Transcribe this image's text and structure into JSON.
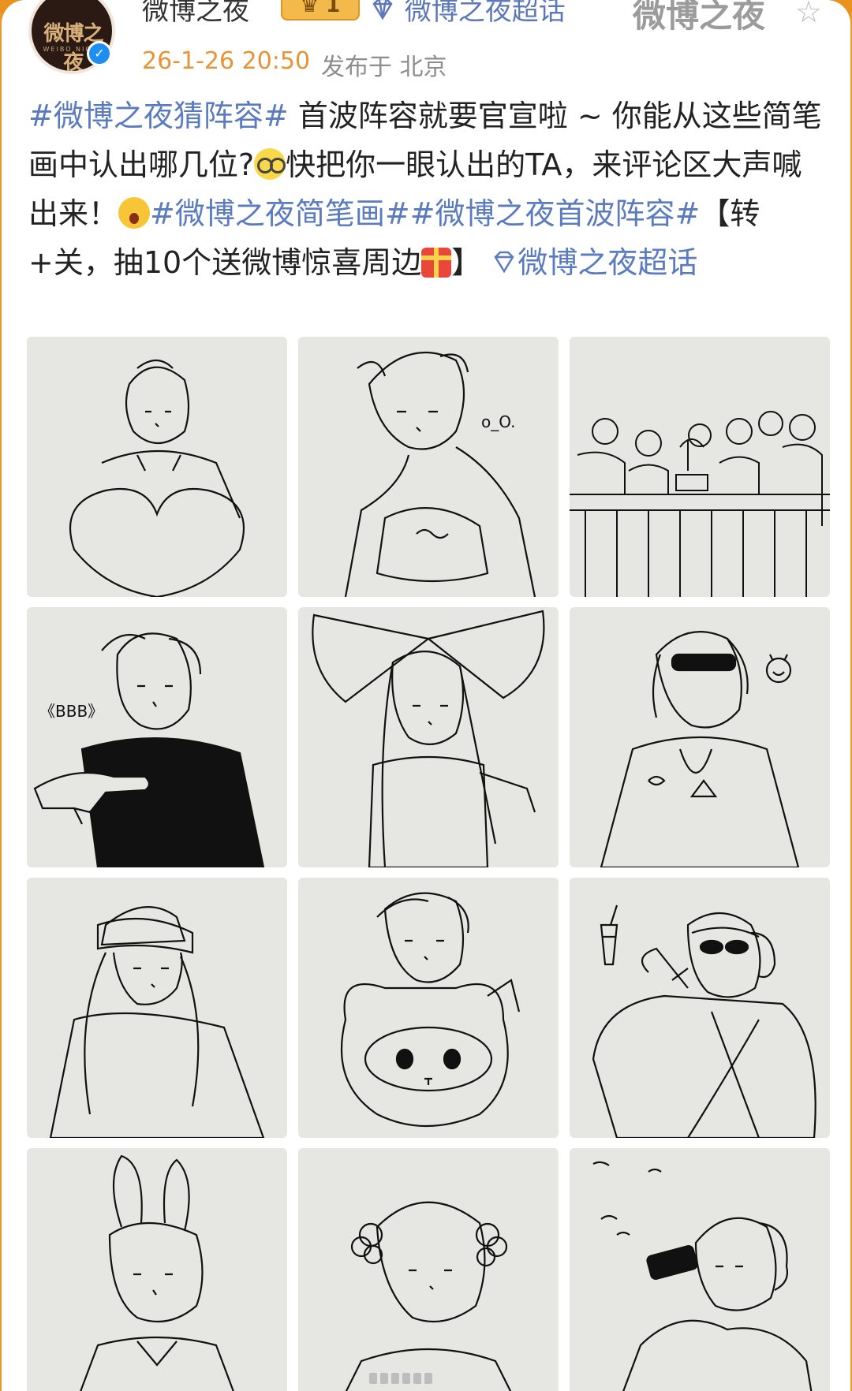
{
  "header": {
    "username": "微博之夜",
    "level": "1",
    "supertopic_label": "微博之夜超话",
    "brand": "微博之夜",
    "timestamp": "26-1-26 20:50",
    "location": "发布于 北京",
    "avatar_title": "微博之夜",
    "avatar_subtitle": "WEIBO NIGHT",
    "verified_mark": "✓"
  },
  "post": {
    "hashtag_1": "#微博之夜猜阵容#",
    "text_1": " 首波阵容就要官宣啦 ~ 你能从这些简笔画中认出哪几位?",
    "text_2": "快把你一眼认出的TA，来评论区大声喊出来！",
    "hashtag_2": "#微博之夜简笔画#",
    "hashtag_3": "#微博之夜首波阵容#",
    "text_3": "【转+关，抽10个送微博惊喜周边",
    "text_4": "】",
    "supertopic_link": "微博之夜超话"
  },
  "images": {
    "caption_oo": "o_O.",
    "caption_bbb": "《BBB》"
  },
  "icons": {
    "star": "star-icon",
    "diamond": "diamond-icon",
    "emoji_1": "glasses-emoji",
    "emoji_2": "shouting-emoji",
    "emoji_3": "gift-emoji"
  },
  "colors": {
    "accent_orange": "#e89436",
    "hashtag_blue": "#5a7bbf",
    "tile_bg": "#e6e6e3"
  }
}
